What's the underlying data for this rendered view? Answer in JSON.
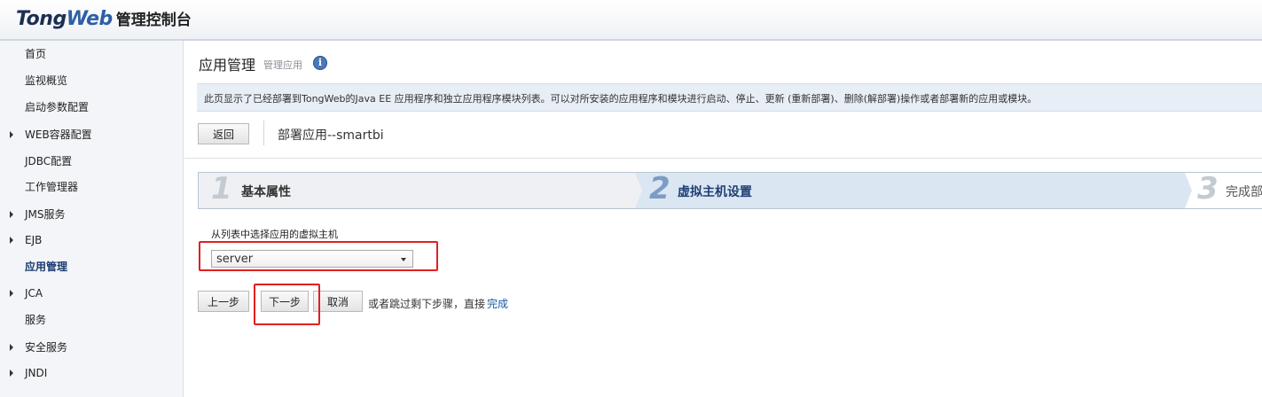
{
  "header": {
    "logo_word_a": "Tong",
    "logo_word_b": "Web",
    "console_title": "管理控制台"
  },
  "sidebar": {
    "items": [
      {
        "label": "首页",
        "expandable": false
      },
      {
        "label": "监视概览",
        "expandable": false
      },
      {
        "label": "启动参数配置",
        "expandable": false
      },
      {
        "label": "WEB容器配置",
        "expandable": true
      },
      {
        "label": "JDBC配置",
        "expandable": false
      },
      {
        "label": "工作管理器",
        "expandable": false
      },
      {
        "label": "JMS服务",
        "expandable": true
      },
      {
        "label": "EJB",
        "expandable": true
      },
      {
        "label": "应用管理",
        "expandable": false,
        "active": true
      },
      {
        "label": "JCA",
        "expandable": true
      },
      {
        "label": "服务",
        "expandable": false
      },
      {
        "label": "安全服务",
        "expandable": true
      },
      {
        "label": "JNDI",
        "expandable": true
      }
    ]
  },
  "main": {
    "title": "应用管理",
    "subtitle": "管理应用",
    "info_icon": "i",
    "description": "此页显示了已经部署到TongWeb的Java EE 应用程序和独立应用程序模块列表。可以对所安装的应用程序和模块进行启动、停止、更新 (重新部署)、删除(解部署)操作或者部署新的应用或模块。",
    "back_label": "返回",
    "deploy_title": "部署应用--smartbi",
    "steps": [
      {
        "num": "1",
        "label": "基本属性"
      },
      {
        "num": "2",
        "label": "虚拟主机设置"
      },
      {
        "num": "3",
        "label": "完成部"
      }
    ],
    "vhost_label": "从列表中选择应用的虚拟主机",
    "vhost_value": "server",
    "prev_label": "上一步",
    "next_label": "下一步",
    "cancel_label": "取消",
    "skip_text": "或者跳过剩下步骤，直接",
    "finish_link": "完成"
  },
  "colors": {
    "active_step_bg": "#dbe6f3",
    "highlight_red": "#e02020",
    "link_blue": "#1a57a8"
  }
}
